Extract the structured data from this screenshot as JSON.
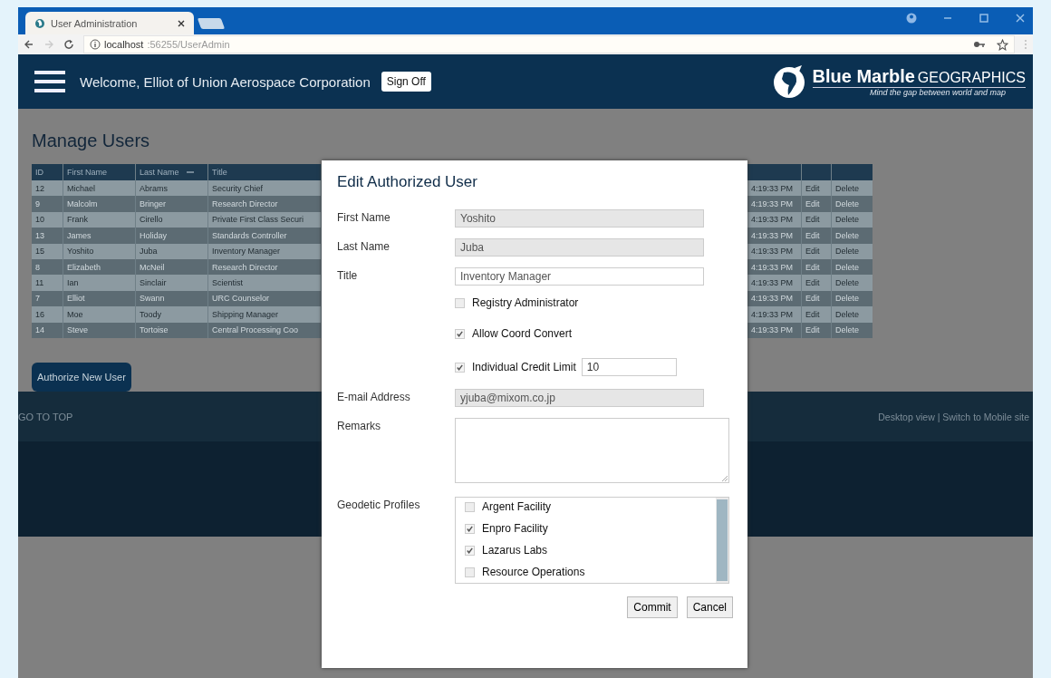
{
  "browser": {
    "tab_title": "User Administration",
    "url_host": "localhost",
    "url_path": ":56255/UserAdmin"
  },
  "header": {
    "welcome": "Welcome, Elliot of Union Aerospace Corporation",
    "sign_off": "Sign Off",
    "brand_main": "Blue Marble",
    "brand_sub": "GEOGRAPHICS",
    "tagline": "Mind the gap between world and map"
  },
  "page_title": "Manage Users",
  "table": {
    "columns": [
      "ID",
      "First Name",
      "Last Name",
      "Title"
    ],
    "rows": [
      {
        "id": "12",
        "first": "Michael",
        "last": "Abrams",
        "title": "Security Chief",
        "time": "4:19:33 PM",
        "edit": "Edit",
        "delete": "Delete"
      },
      {
        "id": "9",
        "first": "Malcolm",
        "last": "Bringer",
        "title": "Research Director",
        "time": "4:19:33 PM",
        "edit": "Edit",
        "delete": "Delete"
      },
      {
        "id": "10",
        "first": "Frank",
        "last": "Cirello",
        "title": "Private First Class Securi",
        "time": "4:19:33 PM",
        "edit": "Edit",
        "delete": "Delete"
      },
      {
        "id": "13",
        "first": "James",
        "last": "Holiday",
        "title": "Standards Controller",
        "time": "4:19:33 PM",
        "edit": "Edit",
        "delete": "Delete"
      },
      {
        "id": "15",
        "first": "Yoshito",
        "last": "Juba",
        "title": "Inventory Manager",
        "time": "4:19:33 PM",
        "edit": "Edit",
        "delete": "Delete"
      },
      {
        "id": "8",
        "first": "Elizabeth",
        "last": "McNeil",
        "title": "Research Director",
        "time": "4:19:33 PM",
        "edit": "Edit",
        "delete": "Delete"
      },
      {
        "id": "11",
        "first": "Ian",
        "last": "Sinclair",
        "title": "Scientist",
        "time": "4:19:33 PM",
        "edit": "Edit",
        "delete": "Delete"
      },
      {
        "id": "7",
        "first": "Elliot",
        "last": "Swann",
        "title": "URC Counselor",
        "time": "4:19:33 PM",
        "edit": "Edit",
        "delete": "Delete"
      },
      {
        "id": "16",
        "first": "Moe",
        "last": "Toody",
        "title": "Shipping Manager",
        "time": "4:19:33 PM",
        "edit": "Edit",
        "delete": "Delete"
      },
      {
        "id": "14",
        "first": "Steve",
        "last": "Tortoise",
        "title": "Central Processing Coo",
        "time": "4:19:33 PM",
        "edit": "Edit",
        "delete": "Delete"
      }
    ]
  },
  "authorize_button": "Authorize New User",
  "footer": {
    "go_top": "GO TO TOP",
    "links": "Desktop view | Switch to Mobile site"
  },
  "dialog": {
    "title": "Edit Authorized User",
    "fields": [
      {
        "kind": "text",
        "label": "First Name",
        "value": "Yoshito",
        "disabled": true
      },
      {
        "kind": "text",
        "label": "Last Name",
        "value": "Juba",
        "disabled": true
      },
      {
        "kind": "text",
        "label": "Title",
        "value": "Inventory Manager",
        "disabled": false
      },
      {
        "kind": "checkbox",
        "label": "Registry Administrator",
        "checked": false
      },
      {
        "kind": "checkbox",
        "label": "Allow Coord Convert",
        "checked": true
      },
      {
        "kind": "checkbox",
        "label": "Individual Credit Limit",
        "checked": true,
        "value": "10"
      },
      {
        "kind": "text",
        "label": "E-mail Address",
        "value": "yjuba@mixom.co.jp",
        "disabled": true
      },
      {
        "kind": "textarea",
        "label": "Remarks"
      },
      {
        "kind": "list",
        "label": "Geodetic Profiles",
        "items": [
          {
            "label": "Argent Facility",
            "checked": false
          },
          {
            "label": "Enpro Facility",
            "checked": true
          },
          {
            "label": "Lazarus Labs",
            "checked": true
          },
          {
            "label": "Resource Operations",
            "checked": false
          }
        ]
      }
    ],
    "buttons": [
      "Commit",
      "Cancel"
    ]
  }
}
